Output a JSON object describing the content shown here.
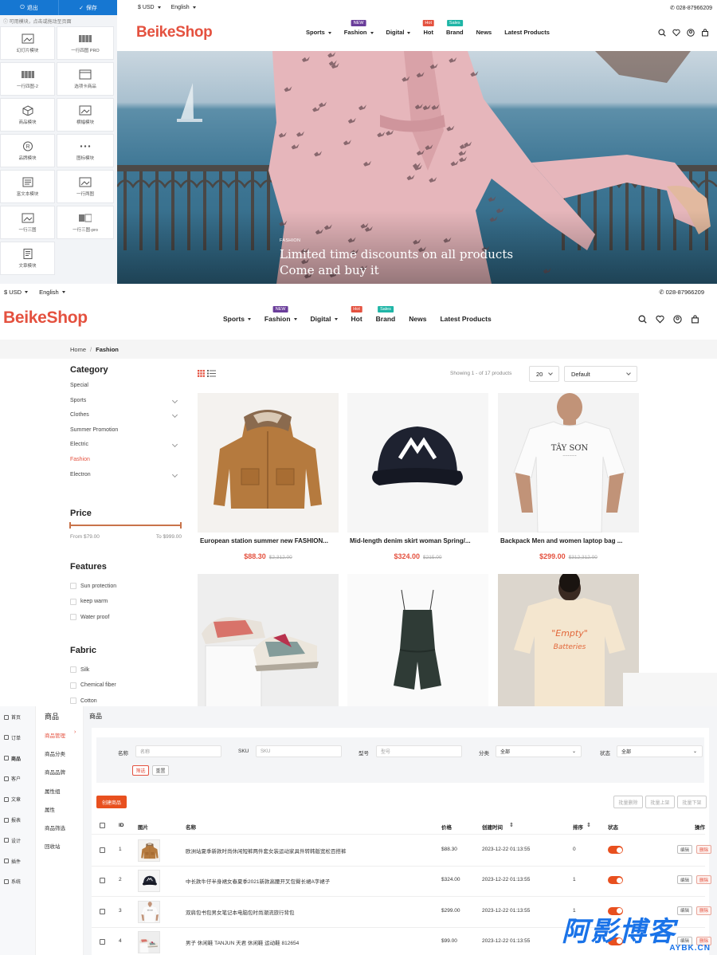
{
  "builder": {
    "exit_label": "退出",
    "save_label": "保存",
    "hint": "可用模块，点击或拖动至页面",
    "modules": [
      "幻灯片模块",
      "一行四图 PRO",
      "一行四图-2",
      "选项卡商品",
      "商品模块",
      "横幅模块",
      "品牌模块",
      "图标模块",
      "富文本模块",
      "一行两图",
      "一行三图",
      "一行三图-pro",
      "文章模块"
    ]
  },
  "store": {
    "currency": "$ USD",
    "language": "English",
    "phone": "028-87966209",
    "logo": "BeikeShop",
    "nav": [
      {
        "label": "Sports",
        "dropdown": true,
        "badge": ""
      },
      {
        "label": "Fashion",
        "dropdown": true,
        "badge": "NEW",
        "badge_color": "#6a3d9a"
      },
      {
        "label": "Digital",
        "dropdown": true,
        "badge": ""
      },
      {
        "label": "Hot",
        "dropdown": false,
        "badge": "Hot",
        "badge_color": "#e4513f"
      },
      {
        "label": "Brand",
        "dropdown": false,
        "badge": "Sales",
        "badge_color": "#1eb5a6"
      },
      {
        "label": "News",
        "dropdown": false,
        "badge": ""
      },
      {
        "label": "Latest Products",
        "dropdown": false,
        "badge": ""
      }
    ],
    "header_icons": [
      "search-icon",
      "heart-icon",
      "user-icon",
      "cart-icon"
    ]
  },
  "hero": {
    "tag": "FASHION",
    "line1": "Limited time discounts on all products",
    "line2": "Come and buy it"
  },
  "listing": {
    "breadcrumb": [
      "Home",
      "Fashion"
    ],
    "category_title": "Category",
    "categories": [
      {
        "label": "Special",
        "expand": false,
        "active": false
      },
      {
        "label": "Sports",
        "expand": true,
        "active": false
      },
      {
        "label": "Clothes",
        "expand": true,
        "active": false
      },
      {
        "label": "Summer Promotion",
        "expand": false,
        "active": false
      },
      {
        "label": "Electric",
        "expand": true,
        "active": false
      },
      {
        "label": "Fashion",
        "expand": false,
        "active": true
      },
      {
        "label": "Electron",
        "expand": true,
        "active": false
      }
    ],
    "price_title": "Price",
    "price_from": "From $79.00",
    "price_to": "To $999.00",
    "features_title": "Features",
    "features": [
      "Sun protection",
      "keep warm",
      "Water proof"
    ],
    "fabric_title": "Fabric",
    "fabrics": [
      "Silk",
      "Chemical fiber",
      "Cotton"
    ],
    "showing": "Showing 1 - of 17 products",
    "per_page": "20",
    "sort": "Default",
    "accent": "#e4513f",
    "products": [
      {
        "name": "European station summer new FASHION...",
        "price": "$88.30",
        "old": "$2,312.00",
        "img": "jacket"
      },
      {
        "name": "Mid-length denim skirt woman Spring/...",
        "price": "$324.00",
        "old": "$215.00",
        "img": "cap"
      },
      {
        "name": "Backpack Men and women laptop bag ...",
        "price": "$299.00",
        "old": "$312,312.00",
        "img": "tshirt"
      },
      {
        "name": "",
        "price": "",
        "old": "",
        "img": "sneakers"
      },
      {
        "name": "",
        "price": "",
        "old": "",
        "img": "romper"
      },
      {
        "name": "",
        "price": "",
        "old": "",
        "img": "tee-back"
      }
    ],
    "tshirt_print": "TÂY SƠN",
    "tee_back_print": "\"Empty\" Batteries"
  },
  "admin": {
    "left_nav": [
      "首页",
      "订单",
      "商品",
      "客户",
      "文章",
      "报表",
      "设计",
      "插件",
      "系统"
    ],
    "section_title": "商品",
    "sub_nav": [
      "商品管理",
      "商品分类",
      "商品品牌",
      "属性组",
      "属性",
      "商品筛选",
      "回收站"
    ],
    "page_title": "商品",
    "filters": {
      "name_label": "名称",
      "name_placeholder": "名称",
      "sku_label": "SKU",
      "sku_placeholder": "SKU",
      "model_label": "型号",
      "model_placeholder": "型号",
      "category_label": "分类",
      "category_value": "全部",
      "status_label": "状态",
      "status_value": "全部",
      "filter_btn": "筛选",
      "reset_btn": "重置"
    },
    "create_btn": "创建商品",
    "batch_buttons": [
      "批量删除",
      "批量上架",
      "批量下架"
    ],
    "columns": [
      "ID",
      "图片",
      "名称",
      "价格",
      "创建时间",
      "排序",
      "状态",
      "操作"
    ],
    "rows": [
      {
        "id": "1",
        "name": "欧洲站夏季新款时尚休闲短裤两件套女装运动家具件转韩版宽松百搭裤",
        "price": "$88.30",
        "created": "2023-12-22 01:13:55",
        "sort": "0",
        "img": "jacket"
      },
      {
        "id": "2",
        "name": "中长款牛仔半身裙女春夏季2021新款高腰开叉包臀长裙A字裙子",
        "price": "$324.00",
        "created": "2023-12-22 01:13:55",
        "sort": "1",
        "img": "cap"
      },
      {
        "id": "3",
        "name": "双肩包书包男女笔记本电脑包时尚潮流旅行背包",
        "price": "$299.00",
        "created": "2023-12-22 01:13:55",
        "sort": "1",
        "img": "tshirt"
      },
      {
        "id": "4",
        "name": "男子 休闲鞋 TANJUN 天君 休闲鞋 运动鞋 812654",
        "price": "$99.00",
        "created": "2023-12-22 01:13:55",
        "sort": "",
        "img": "sneakers"
      }
    ],
    "edit_label": "编辑",
    "delete_label": "删除"
  },
  "watermark": {
    "text": "阿影博客",
    "sub": "AYBK.CN"
  }
}
